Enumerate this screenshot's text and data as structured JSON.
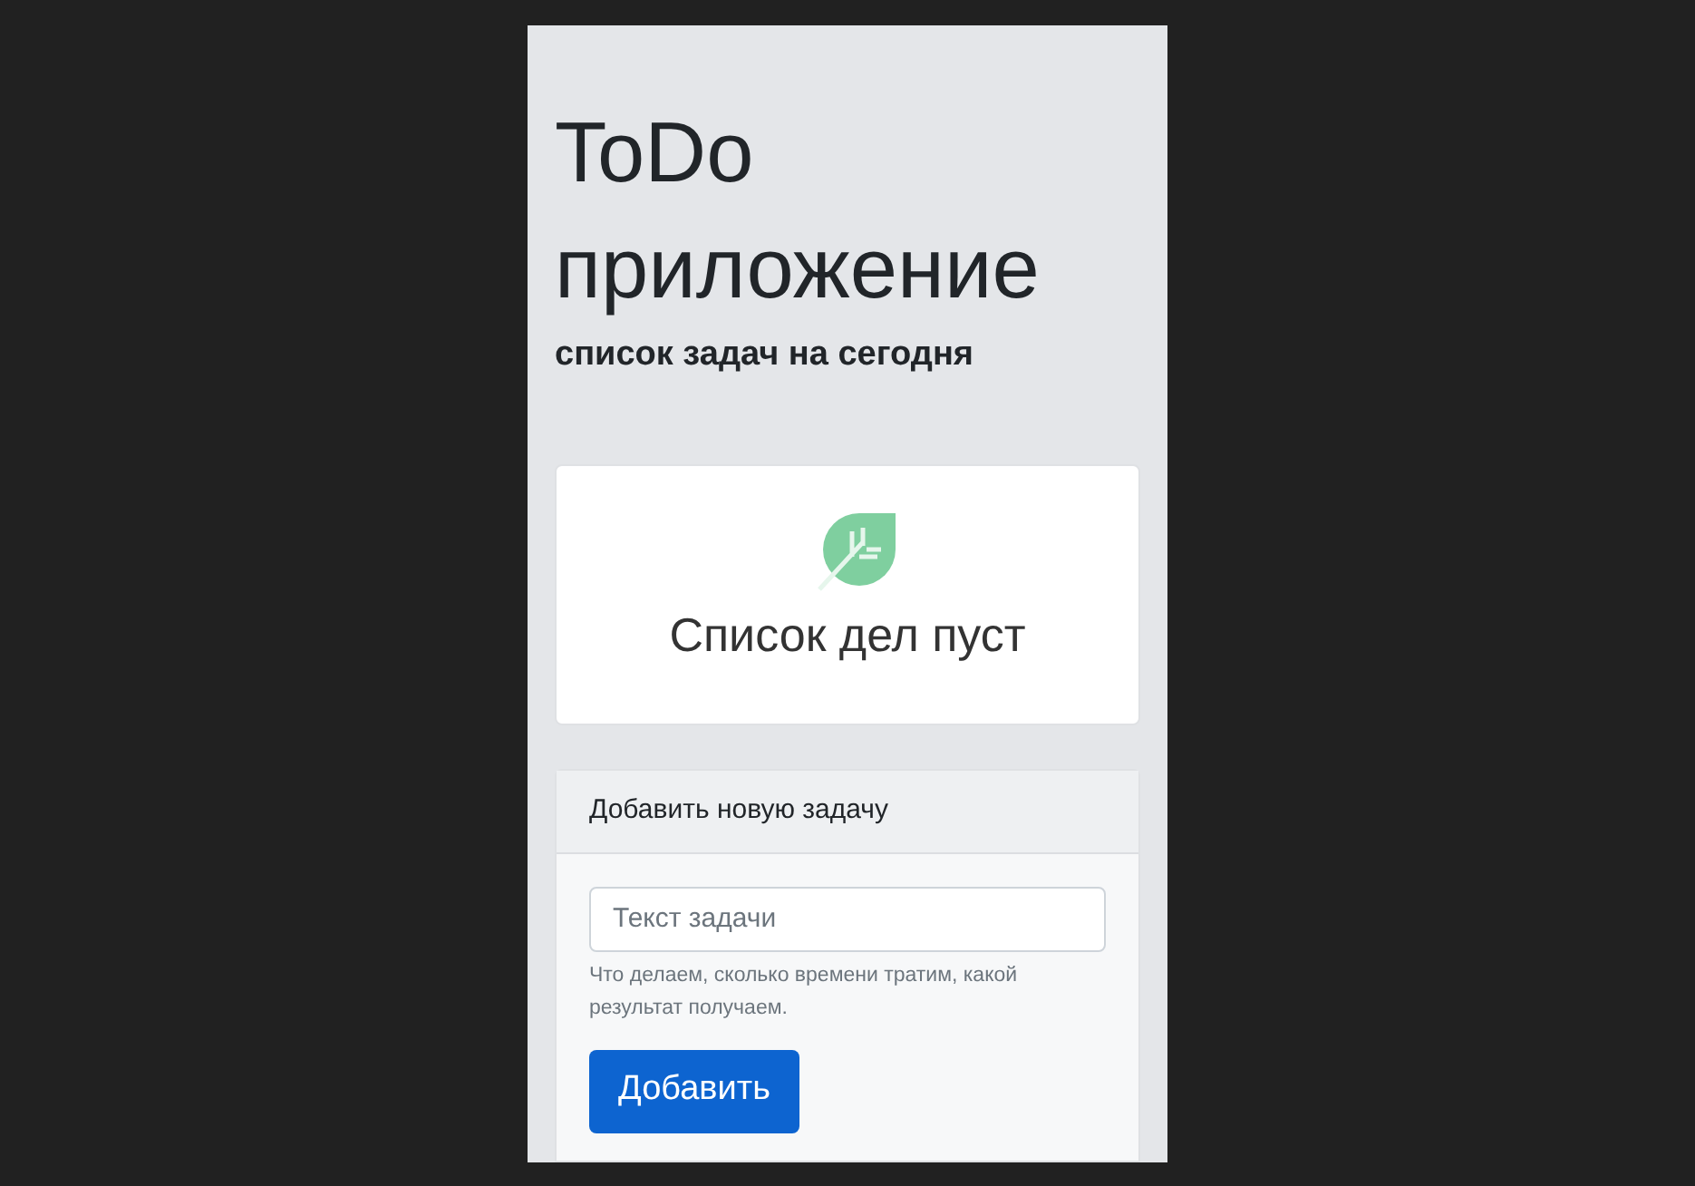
{
  "header": {
    "title": "ToDo приложение",
    "subtitle": "список задач на сегодня"
  },
  "empty_state": {
    "message": "Список дел пуст"
  },
  "add_form": {
    "heading": "Добавить новую задачу",
    "input": {
      "placeholder": "Текст задачи"
    },
    "help": "Что делаем, сколько времени тратим, какой результат получаем.",
    "button": "Добавить"
  }
}
